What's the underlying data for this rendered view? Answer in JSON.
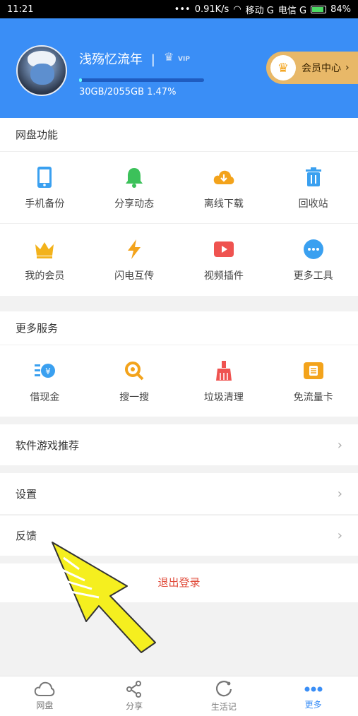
{
  "status_bar": {
    "time": "11:21",
    "network_speed": "0.91K/s",
    "carrier1": "移动 G",
    "carrier2": "电信 G",
    "battery": "84%"
  },
  "profile": {
    "username": "浅殇忆流年",
    "separator": "|",
    "vip_badge": "VIP",
    "storage_text": "30GB/2055GB 1.47%",
    "storage_progress": 0.0147,
    "vip_center_label": "会员中心"
  },
  "netdisk": {
    "title": "网盘功能",
    "rows": [
      [
        {
          "label": "手机备份",
          "icon": "phone-icon",
          "color": "#3aa0f0"
        },
        {
          "label": "分享动态",
          "icon": "bell-icon",
          "color": "#3cc15a"
        },
        {
          "label": "离线下载",
          "icon": "cloud-download-icon",
          "color": "#f3a31b"
        },
        {
          "label": "回收站",
          "icon": "trash-icon",
          "color": "#3aa0f0"
        }
      ],
      [
        {
          "label": "我的会员",
          "icon": "crown-icon",
          "color": "#f3b21b"
        },
        {
          "label": "闪电互传",
          "icon": "lightning-icon",
          "color": "#f3a31b"
        },
        {
          "label": "视频插件",
          "icon": "video-play-icon",
          "color": "#ef5350"
        },
        {
          "label": "更多工具",
          "icon": "more-dots-icon",
          "color": "#3aa0f0"
        }
      ]
    ]
  },
  "services": {
    "title": "更多服务",
    "items": [
      {
        "label": "借现金",
        "icon": "cash-icon",
        "color": "#3aa0f0"
      },
      {
        "label": "搜一搜",
        "icon": "search-icon",
        "color": "#f3a31b"
      },
      {
        "label": "垃圾清理",
        "icon": "broom-icon",
        "color": "#ef5350"
      },
      {
        "label": "免流量卡",
        "icon": "sim-card-icon",
        "color": "#f3a31b"
      }
    ]
  },
  "list": {
    "recommend": "软件游戏推荐",
    "settings": "设置",
    "feedback": "反馈",
    "logout": "退出登录"
  },
  "tabs": [
    {
      "label": "网盘",
      "icon": "cloud-icon"
    },
    {
      "label": "分享",
      "icon": "share-icon"
    },
    {
      "label": "生活记",
      "icon": "refresh-circle-icon"
    },
    {
      "label": "更多",
      "icon": "more-icon"
    }
  ],
  "colors": {
    "header_blue": "#3a8ef6",
    "vip_gold": "#e8b868",
    "logout_red": "#e04b3a",
    "annotation_yellow": "#f5ef1f"
  }
}
